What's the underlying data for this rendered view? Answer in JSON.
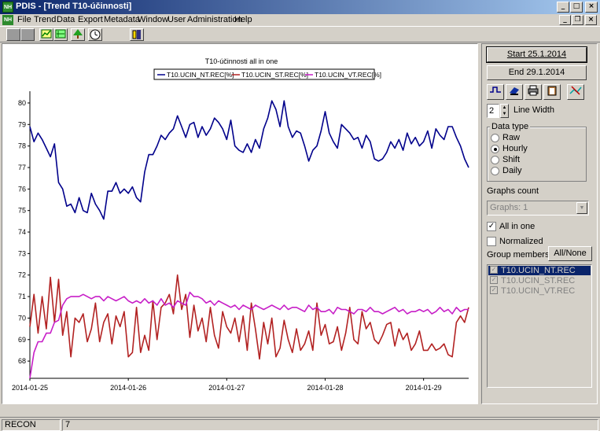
{
  "window": {
    "app_title": "PDIS - [Trend T10-účinnosti]",
    "icon": "pdis-app-icon"
  },
  "menu": [
    "File",
    "Trend",
    "Data",
    "Export",
    "Metadata",
    "Window",
    "User",
    "Administration",
    "Help"
  ],
  "toolbar": {
    "icons": [
      "gray-square-icon",
      "gray-square-icon",
      "trend-single-icon",
      "trend-multi-icon",
      "tree-icon",
      "clock-icon",
      "user-icon"
    ]
  },
  "controls": {
    "start_label": "Start 25.1.2014",
    "end_label": "End 29.1.2014",
    "line_width_value": "2",
    "line_width_label": "Line Width",
    "data_type_title": "Data type",
    "data_types": [
      "Raw",
      "Hourly",
      "Shift",
      "Daily"
    ],
    "selected_data_type": "Hourly",
    "graphs_count_label": "Graphs count",
    "graphs_value": "Graphs: 1",
    "all_in_one_label": "All in one",
    "all_in_one_checked": true,
    "normalized_label": "Normalized",
    "normalized_checked": false,
    "group_members_label": "Group members",
    "all_none_label": "All/None",
    "members": [
      "T10.UCIN_NT.REC",
      "T10.UCIN_ST.REC",
      "T10.UCIN_VT.REC"
    ],
    "small_icons": [
      "step-line-icon",
      "eraser-icon",
      "printer-icon",
      "clipboard-icon",
      "remove-series-icon"
    ]
  },
  "status": {
    "user": "RECON",
    "count": "7"
  },
  "chart_data": {
    "type": "line",
    "title": "T10-účinnosti all in one",
    "legend_placement": "top-center",
    "ylim": [
      67.2,
      80.4
    ],
    "yticks": [
      68,
      69,
      70,
      71,
      72,
      73,
      74,
      75,
      76,
      77,
      78,
      79,
      80
    ],
    "xlim": [
      0,
      107
    ],
    "x_unit": "hours since 2014-01-25 00:00",
    "xtick_labels": [
      "2014-01-25",
      "2014-01-26",
      "2014-01-27",
      "2014-01-28",
      "2014-01-29"
    ],
    "xticks": [
      0,
      24,
      48,
      72,
      96
    ],
    "grid": false,
    "series": [
      {
        "name": "T10.UCIN_NT.REC[%]",
        "color": "#00008b",
        "x": [
          0,
          1,
          2,
          3,
          4,
          5,
          6,
          7,
          8,
          9,
          10,
          11,
          12,
          13,
          14,
          15,
          16,
          17,
          18,
          19,
          20,
          21,
          22,
          23,
          24,
          25,
          26,
          27,
          28,
          29,
          30,
          31,
          32,
          33,
          34,
          35,
          36,
          37,
          38,
          39,
          40,
          41,
          42,
          43,
          44,
          45,
          46,
          47,
          48,
          49,
          50,
          51,
          52,
          53,
          54,
          55,
          56,
          57,
          58,
          59,
          60,
          61,
          62,
          63,
          64,
          65,
          66,
          67,
          68,
          69,
          70,
          71,
          72,
          73,
          74,
          75,
          76,
          77,
          78,
          79,
          80,
          81,
          82,
          83,
          84,
          85,
          86,
          87,
          88,
          89,
          90,
          91,
          92,
          93,
          94,
          95,
          96,
          97,
          98,
          99,
          100,
          101,
          102,
          103,
          104,
          105,
          106,
          107
        ],
        "y": [
          78.9,
          78.2,
          78.6,
          78.3,
          77.9,
          77.5,
          78.1,
          76.3,
          76.0,
          75.2,
          75.3,
          74.9,
          75.6,
          75.0,
          74.9,
          75.8,
          75.3,
          75.0,
          74.6,
          75.9,
          75.9,
          76.3,
          75.8,
          76.0,
          75.8,
          76.1,
          75.6,
          75.4,
          76.8,
          77.6,
          77.6,
          78.0,
          78.5,
          78.3,
          78.6,
          78.8,
          79.4,
          78.9,
          78.4,
          79.0,
          79.1,
          78.4,
          78.9,
          78.5,
          78.8,
          79.3,
          79.1,
          78.8,
          78.3,
          79.2,
          78.0,
          77.8,
          77.7,
          78.1,
          77.7,
          78.3,
          77.9,
          78.8,
          79.3,
          80.1,
          79.7,
          78.9,
          80.1,
          78.9,
          78.4,
          78.7,
          78.6,
          78.0,
          77.3,
          77.8,
          78.0,
          78.7,
          79.6,
          78.6,
          78.2,
          77.9,
          79.0,
          78.8,
          78.6,
          78.3,
          78.4,
          77.9,
          78.5,
          78.2,
          77.4,
          77.3,
          77.4,
          77.7,
          78.2,
          77.9,
          78.3,
          77.8,
          78.6,
          78.1,
          78.4,
          78.0,
          78.2,
          78.7,
          77.9,
          78.8,
          78.5,
          78.3,
          78.9,
          78.9,
          78.4,
          78.0,
          77.4,
          77.0
        ]
      },
      {
        "name": "T10.UCIN_ST.REC[%]",
        "color": "#b22222",
        "x": [
          0,
          1,
          2,
          3,
          4,
          5,
          6,
          7,
          8,
          9,
          10,
          11,
          12,
          13,
          14,
          15,
          16,
          17,
          18,
          19,
          20,
          21,
          22,
          23,
          24,
          25,
          26,
          27,
          28,
          29,
          30,
          31,
          32,
          33,
          34,
          35,
          36,
          37,
          38,
          39,
          40,
          41,
          42,
          43,
          44,
          45,
          46,
          47,
          48,
          49,
          50,
          51,
          52,
          53,
          54,
          55,
          56,
          57,
          58,
          59,
          60,
          61,
          62,
          63,
          64,
          65,
          66,
          67,
          68,
          69,
          70,
          71,
          72,
          73,
          74,
          75,
          76,
          77,
          78,
          79,
          80,
          81,
          82,
          83,
          84,
          85,
          86,
          87,
          88,
          89,
          90,
          91,
          92,
          93,
          94,
          95,
          96,
          97,
          98,
          99,
          100,
          101,
          102,
          103,
          104,
          105,
          106,
          107
        ],
        "y": [
          69.6,
          71.1,
          69.3,
          71.0,
          69.5,
          71.9,
          69.8,
          71.8,
          69.2,
          70.3,
          68.2,
          70.0,
          69.8,
          70.2,
          68.9,
          69.5,
          70.7,
          68.9,
          69.8,
          70.2,
          68.8,
          70.1,
          69.6,
          70.3,
          68.2,
          68.4,
          70.5,
          68.4,
          69.2,
          68.5,
          70.8,
          69.0,
          70.5,
          70.7,
          71.1,
          70.2,
          72.0,
          70.4,
          71.1,
          69.1,
          70.6,
          69.4,
          70.0,
          68.9,
          70.5,
          69.2,
          68.6,
          70.3,
          69.6,
          69.3,
          70.0,
          68.9,
          70.1,
          68.5,
          70.7,
          69.5,
          68.1,
          69.8,
          68.8,
          70.0,
          68.2,
          68.6,
          69.9,
          69.0,
          68.4,
          69.5,
          68.5,
          68.8,
          69.4,
          68.5,
          70.7,
          69.2,
          69.7,
          68.8,
          68.9,
          69.6,
          68.5,
          69.3,
          70.5,
          69.0,
          68.8,
          70.3,
          69.5,
          69.8,
          69.0,
          68.8,
          69.2,
          69.7,
          69.8,
          68.7,
          69.5,
          69.0,
          69.3,
          68.5,
          68.8,
          69.4,
          68.5,
          68.5,
          68.8,
          68.5,
          68.6,
          68.8,
          68.3,
          68.2,
          69.8,
          70.1,
          69.8,
          70.5
        ]
      },
      {
        "name": "T10.UCIN_VT.REC[%]",
        "color": "#c71ec7",
        "x": [
          0,
          1,
          2,
          3,
          4,
          5,
          6,
          7,
          8,
          9,
          10,
          11,
          12,
          13,
          14,
          15,
          16,
          17,
          18,
          19,
          20,
          21,
          22,
          23,
          24,
          25,
          26,
          27,
          28,
          29,
          30,
          31,
          32,
          33,
          34,
          35,
          36,
          37,
          38,
          39,
          40,
          41,
          42,
          43,
          44,
          45,
          46,
          47,
          48,
          49,
          50,
          51,
          52,
          53,
          54,
          55,
          56,
          57,
          58,
          59,
          60,
          61,
          62,
          63,
          64,
          65,
          66,
          67,
          68,
          69,
          70,
          71,
          72,
          73,
          74,
          75,
          76,
          77,
          78,
          79,
          80,
          81,
          82,
          83,
          84,
          85,
          86,
          87,
          88,
          89,
          90,
          91,
          92,
          93,
          94,
          95,
          96,
          97,
          98,
          99,
          100,
          101,
          102,
          103,
          104,
          105,
          106,
          107
        ],
        "y": [
          67.2,
          68.4,
          68.9,
          68.9,
          69.3,
          69.3,
          69.8,
          69.9,
          70.6,
          70.9,
          71.0,
          71.0,
          71.0,
          71.1,
          71.0,
          70.9,
          71.0,
          71.0,
          70.8,
          71.0,
          70.9,
          70.8,
          70.9,
          71.0,
          70.8,
          70.7,
          70.8,
          70.7,
          70.9,
          70.7,
          70.8,
          70.6,
          70.9,
          70.6,
          70.7,
          70.5,
          70.8,
          70.7,
          70.6,
          71.2,
          71.0,
          71.0,
          70.9,
          70.7,
          70.8,
          70.6,
          70.8,
          70.7,
          70.6,
          70.5,
          70.6,
          70.4,
          70.6,
          70.5,
          70.4,
          70.6,
          70.5,
          70.4,
          70.5,
          70.6,
          70.5,
          70.4,
          70.6,
          70.4,
          70.5,
          70.5,
          70.4,
          70.3,
          70.6,
          70.4,
          70.5,
          70.3,
          70.3,
          70.4,
          70.2,
          70.5,
          70.4,
          70.4,
          70.3,
          70.2,
          70.4,
          70.4,
          70.3,
          70.5,
          70.3,
          70.3,
          70.2,
          70.3,
          70.4,
          70.5,
          70.3,
          70.4,
          70.2,
          70.3,
          70.3,
          70.4,
          70.3,
          70.4,
          70.2,
          70.3,
          70.5,
          70.3,
          70.4,
          70.2,
          70.5,
          70.3,
          70.4,
          70.4
        ]
      }
    ]
  }
}
